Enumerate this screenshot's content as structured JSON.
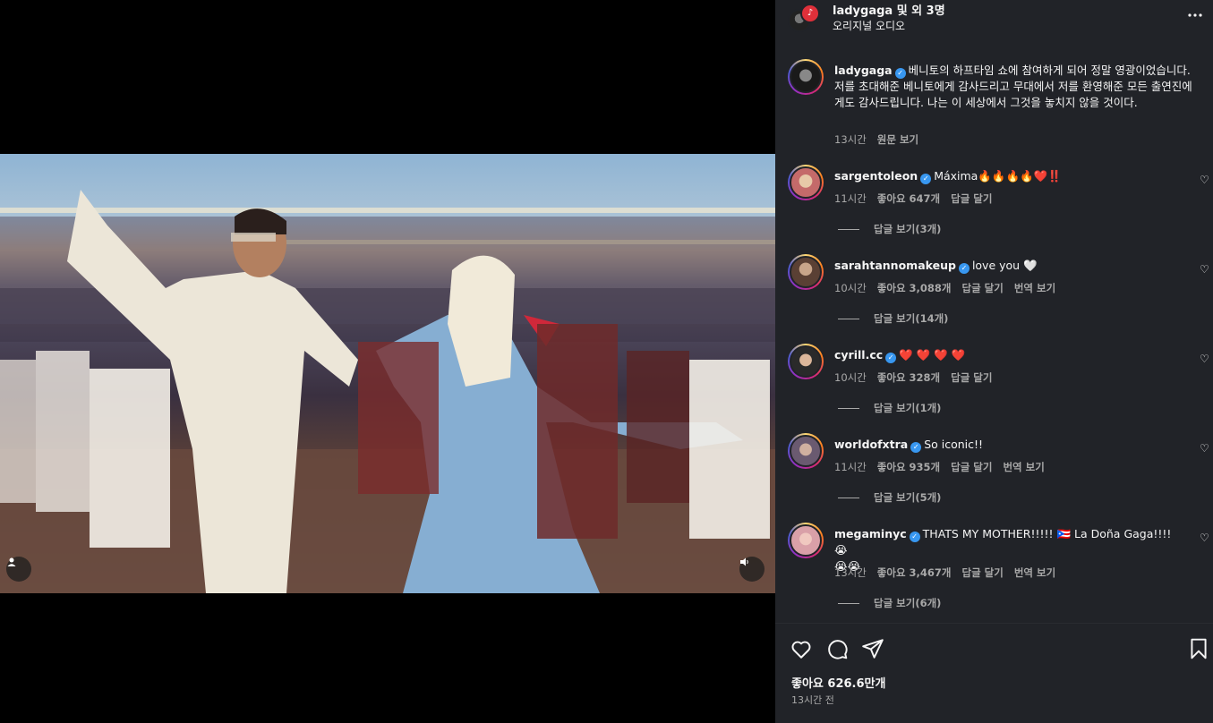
{
  "header": {
    "username": "ladygaga",
    "coauthors": " 및 외 3명",
    "audio": "오리지널 오디오",
    "more_icon": "more-horizontal-icon"
  },
  "caption": {
    "username": "ladygaga",
    "text": "베니토의 하프타임 쇼에 참여하게 되어 정말 영광이었습니다. 저를 초대해준 베니토에게 감사드리고 무대에서 저를 환영해준 모든 출연진에게도 감사드립니다. 나는 이 세상에서 그것을 놓치지 않을 것이다.",
    "time": "13시간",
    "see_translation": "원문 보기"
  },
  "comments": [
    {
      "username": "sargentoleon",
      "text": "Máxima🔥🔥🔥🔥",
      "extra": "❤️‼️",
      "time": "11시간",
      "likes": "좋아요 647개",
      "reply": "답글 달기",
      "translate": "",
      "view_replies": "답글 보기(3개)"
    },
    {
      "username": "sarahtannomakeup",
      "text": "love you 🤍",
      "extra": "",
      "time": "10시간",
      "likes": "좋아요 3,088개",
      "reply": "답글 달기",
      "translate": "번역 보기",
      "view_replies": "답글 보기(14개)"
    },
    {
      "username": "cyrill.cc",
      "text": "",
      "extra": "❤️ ❤️ ❤️ ❤️",
      "time": "10시간",
      "likes": "좋아요 328개",
      "reply": "답글 달기",
      "translate": "",
      "view_replies": "답글 보기(1개)"
    },
    {
      "username": "worldofxtra",
      "text": "So iconic!!",
      "extra": "",
      "time": "11시간",
      "likes": "좋아요 935개",
      "reply": "답글 달기",
      "translate": "번역 보기",
      "view_replies": "답글 보기(5개)"
    },
    {
      "username": "megaminyc",
      "text": "THATS MY MOTHER!!!!! 🇵🇷 La Doña Gaga!!!! 😭",
      "text2": "😭😭",
      "extra": "",
      "time": "13시간",
      "likes": "좋아요 3,467개",
      "reply": "답글 달기",
      "translate": "번역 보기",
      "view_replies": "답글 보기(6개)"
    }
  ],
  "footer": {
    "likes": "좋아요 626.6만개",
    "time_ago": "13시간 전"
  }
}
